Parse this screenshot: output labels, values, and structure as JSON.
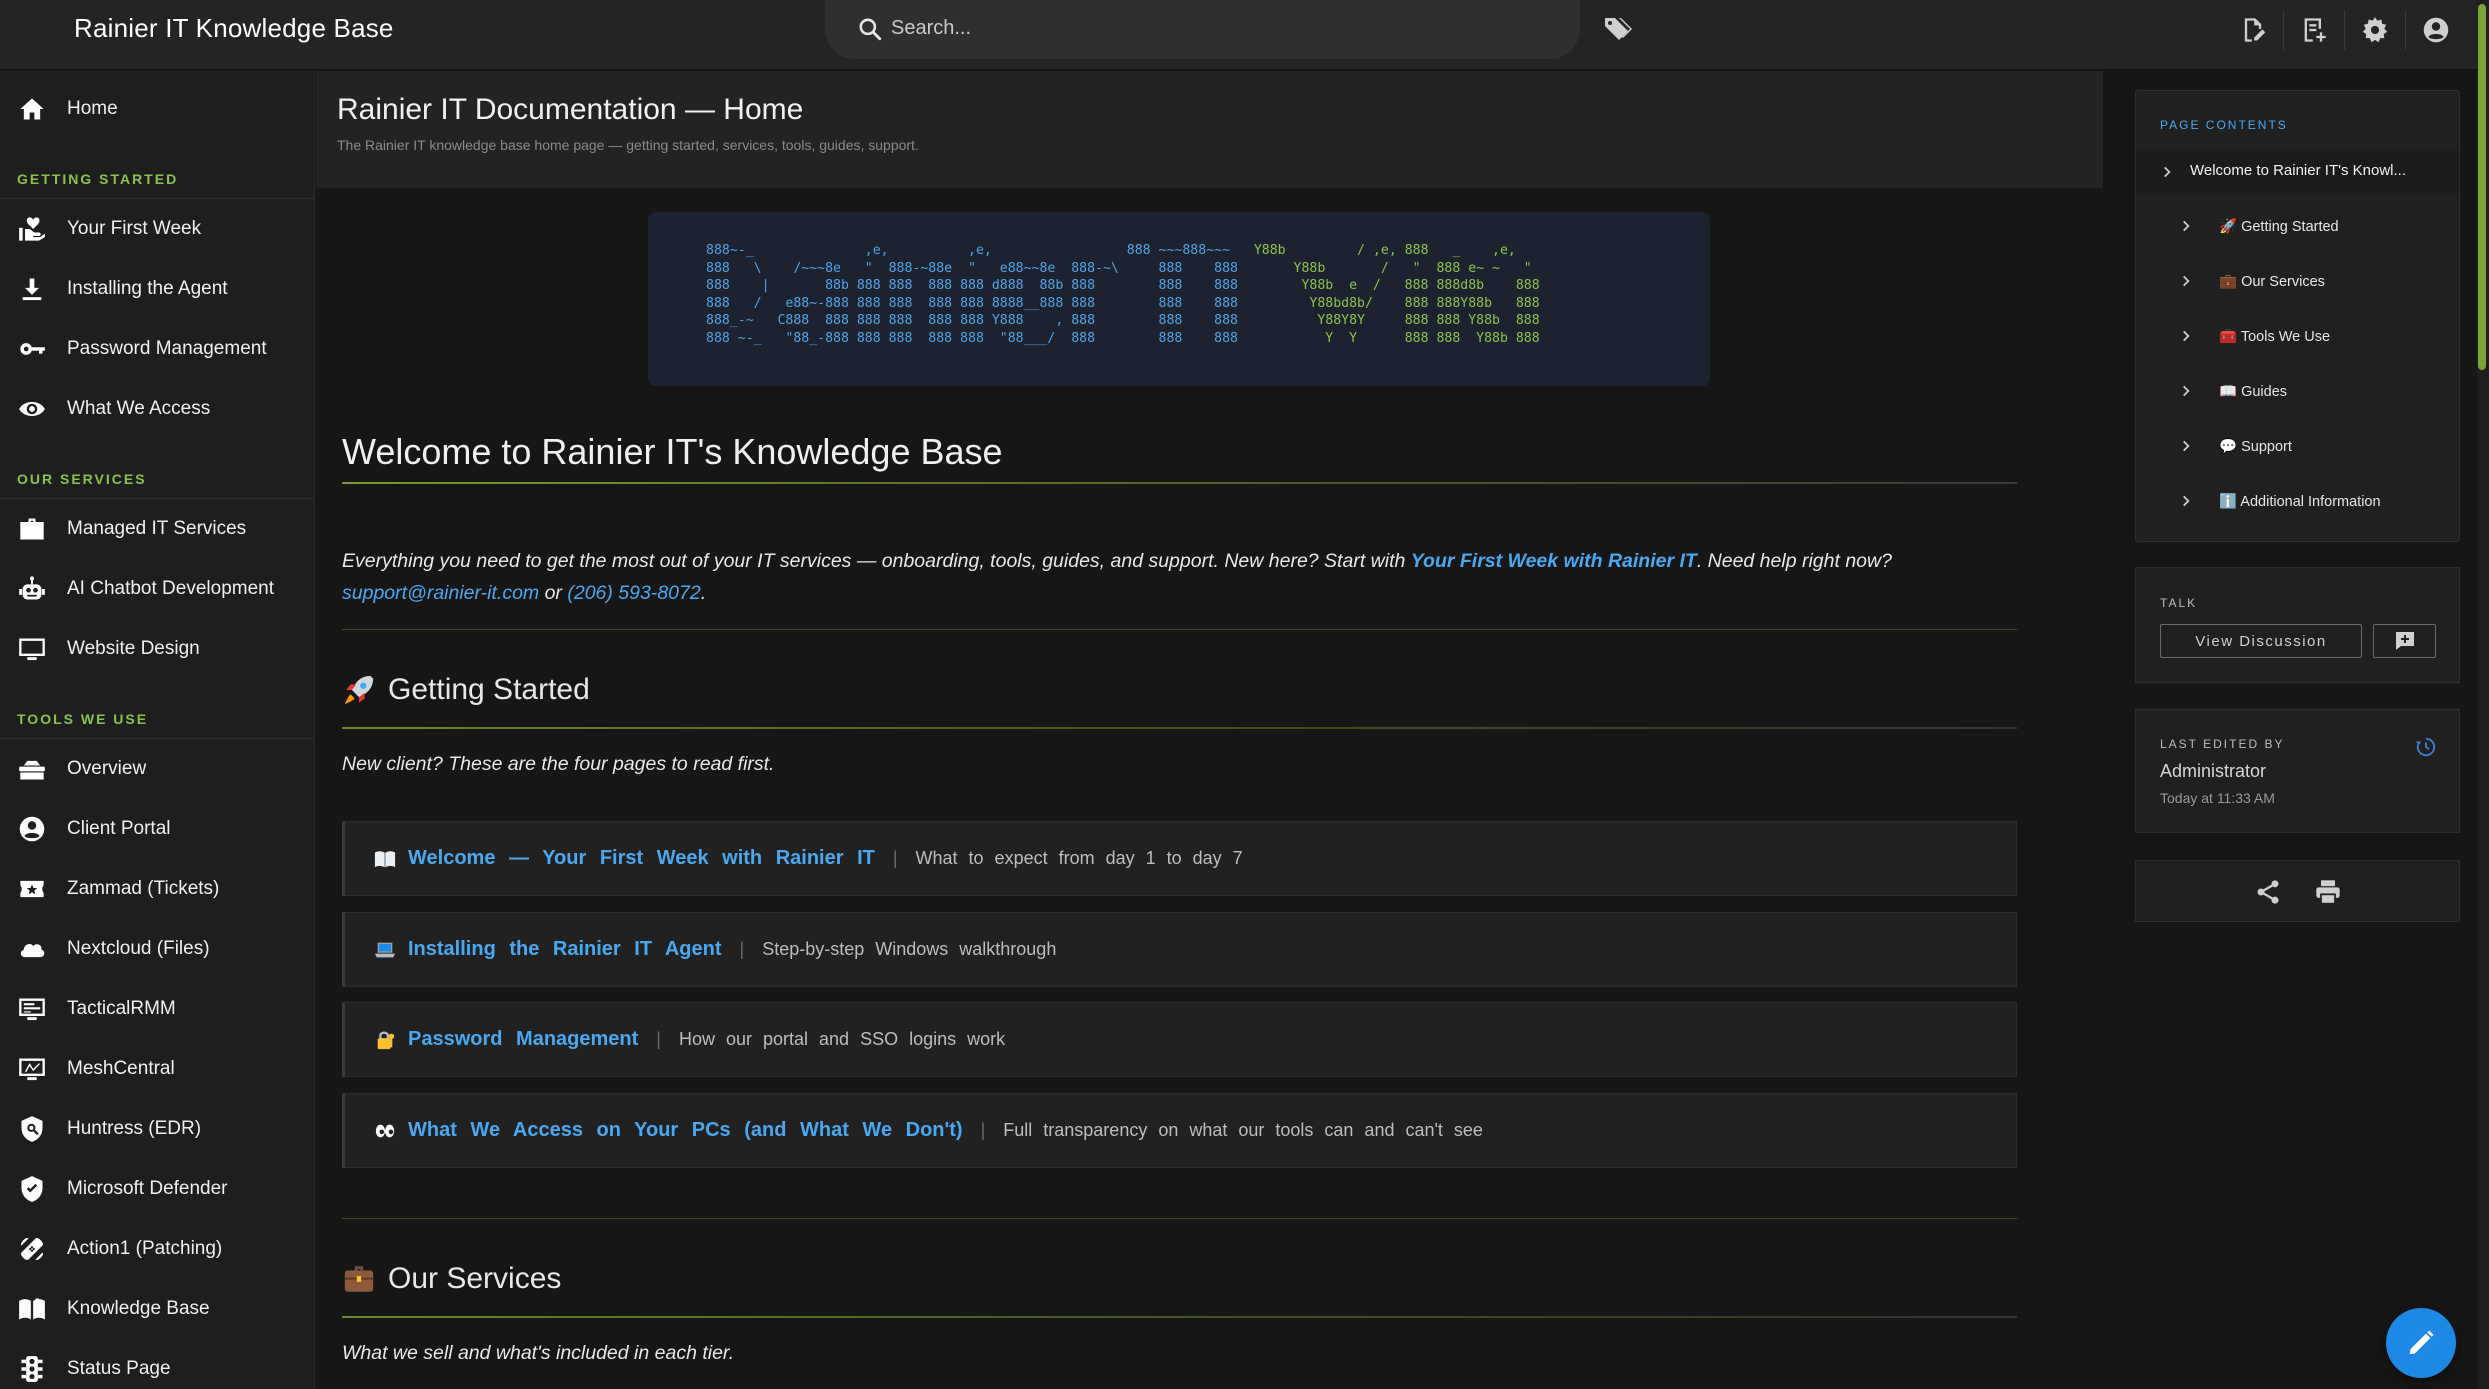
{
  "header": {
    "site_title": "Rainier IT Knowledge Base",
    "search_placeholder": "Search...",
    "icons": [
      "tags-icon",
      "new-page-icon",
      "browse-icon",
      "settings-icon",
      "account-icon"
    ]
  },
  "sidebar": {
    "home": "Home",
    "sections": [
      {
        "heading": "GETTING STARTED",
        "items": [
          "Your First Week",
          "Installing the Agent",
          "Password Management",
          "What We Access"
        ]
      },
      {
        "heading": "OUR SERVICES",
        "items": [
          "Managed IT Services",
          "AI Chatbot Development",
          "Website Design"
        ]
      },
      {
        "heading": "TOOLS WE USE",
        "items": [
          "Overview",
          "Client Portal",
          "Zammad (Tickets)",
          "Nextcloud (Files)",
          "TacticalRMM",
          "MeshCentral",
          "Huntress (EDR)",
          "Microsoft Defender",
          "Action1 (Patching)",
          "Knowledge Base",
          "Status Page"
        ]
      }
    ]
  },
  "page": {
    "title": "Rainier IT Documentation — Home",
    "subtitle": "The Rainier IT knowledge base home page — getting started, services, tools, guides, support.",
    "h1": "Welcome to Rainier IT's Knowledge Base",
    "intro_1": "Everything you need to get the most out of your IT services — onboarding, tools, guides, and support. New here? Start with ",
    "intro_link": "Your First Week with Rainier IT",
    "intro_2": ". Need help right now?",
    "email": "support@rainier-it.com",
    "intro_or": " or ",
    "phone": "(206) 593-8072",
    "intro_end": ".",
    "getting_started": {
      "heading": "Getting Started",
      "emoji": "🚀",
      "lead": "New client? These are the four pages to read first.",
      "cards": [
        {
          "emoji": "📖",
          "title": "Welcome — Your First Week with Rainier IT",
          "desc": "What to expect from day 1 to day 7"
        },
        {
          "emoji": "💻",
          "title": "Installing the Rainier IT Agent",
          "desc": "Step-by-step Windows walkthrough"
        },
        {
          "emoji": "🔐",
          "title": "Password Management",
          "desc": "How our portal and SSO logins work"
        },
        {
          "emoji": "👀",
          "title": "What We Access on Your PCs (and What We Don't)",
          "desc": "Full transparency on what our tools can and can't see"
        }
      ]
    },
    "our_services": {
      "heading": "Our Services",
      "emoji": "💼",
      "lead": "What we sell and what's included in each tier."
    }
  },
  "toc": {
    "heading": "PAGE CONTENTS",
    "top": "Welcome to Rainier IT's Knowl...",
    "items": [
      {
        "emoji": "🚀",
        "label": "Getting Started"
      },
      {
        "emoji": "💼",
        "label": "Our Services"
      },
      {
        "emoji": "🧰",
        "label": "Tools We Use"
      },
      {
        "emoji": "📖",
        "label": "Guides"
      },
      {
        "emoji": "💬",
        "label": "Support"
      },
      {
        "emoji": "ℹ️",
        "label": "Additional Information"
      }
    ]
  },
  "talk": {
    "heading": "TALK",
    "button": "View Discussion"
  },
  "last_edited": {
    "heading": "LAST EDITED BY",
    "name": "Administrator",
    "time": "Today at 11:33 AM"
  },
  "colors": {
    "accent": "#8bc34a",
    "link": "#4aa8f0",
    "fab": "#1e88e5",
    "background": "#161616"
  }
}
